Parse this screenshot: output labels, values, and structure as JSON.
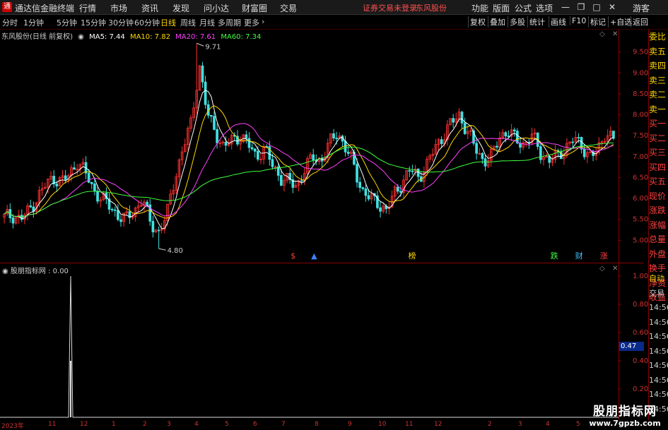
{
  "menubar": {
    "app_title": "通达信金融终端",
    "items": [
      "行情",
      "市场",
      "资讯",
      "发现",
      "问小达",
      "财富圈",
      "交易"
    ],
    "warning": "证券交易未登录",
    "stock_name": "东风股份",
    "right_items": [
      "功能",
      "版面",
      "公式",
      "选项"
    ],
    "guest": "游客"
  },
  "toolbar": {
    "periods": [
      "分时",
      "1分钟",
      "5分钟",
      "15分钟",
      "30分钟",
      "60分钟",
      "日线",
      "周线",
      "月线",
      "多周期",
      "更多"
    ],
    "active_period": "日线",
    "right_buttons": [
      "复权",
      "叠加",
      "多股",
      "统计",
      "画线",
      "F10",
      "标记",
      "+自选",
      "返回"
    ]
  },
  "legend": {
    "name": "东风股份(日线 前复权)",
    "ma5_label": "MA5: 7.44",
    "ma10_label": "MA10: 7.82",
    "ma20_label": "MA20: 7.61",
    "ma60_label": "MA60: 7.34"
  },
  "sublegend": {
    "label": "股朋指标网 : 0.00"
  },
  "price_axis": [
    "9.50",
    "9.00",
    "8.50",
    "8.00",
    "7.50",
    "7.00",
    "6.50",
    "6.00",
    "5.50",
    "5.00"
  ],
  "sub_axis": [
    "1.00",
    "0.80",
    "0.60",
    "0.40",
    "0.20"
  ],
  "sub_current": "0.47",
  "annotations": {
    "high": "9.71",
    "low": "4.80"
  },
  "time_axis": [
    "2023年",
    "11",
    "12",
    "1",
    "2",
    "3",
    "4",
    "5",
    "6",
    "7",
    "8",
    "9",
    "10",
    "11",
    "12",
    "2",
    "3",
    "4",
    "5"
  ],
  "badges": [
    "$",
    "▲",
    "榜",
    "跌",
    "财",
    "涨"
  ],
  "side_list": [
    "委比",
    "卖五",
    "卖四",
    "卖三",
    "卖二",
    "卖一",
    "买一",
    "买二",
    "买三",
    "买四",
    "买五",
    "现价",
    "涨跌",
    "涨幅",
    "总量",
    "外盘",
    "换手",
    "净资",
    "收益"
  ],
  "side_sub": [
    "自动",
    "交易",
    "14:56",
    "14:56",
    "14:56",
    "14:56",
    "14:56",
    "14:56",
    "14:56",
    "14:56"
  ],
  "watermark": {
    "cn": "股朋指标网",
    "url": "www.7gpzb.com"
  },
  "colors": {
    "ma5": "#ffffff",
    "ma10": "#ffd700",
    "ma20": "#ff40ff",
    "ma60": "#40ff40",
    "up": "#ff3030",
    "down": "#40e0e0",
    "grid": "#8a0000"
  },
  "chart_data": {
    "type": "candlestick",
    "title": "东风股份(日线 前复权)",
    "ylim": [
      4.6,
      9.9
    ],
    "high": 9.71,
    "low": 4.8,
    "close_series": [
      5.55,
      5.6,
      5.5,
      5.7,
      6.0,
      6.3,
      6.5,
      6.4,
      6.55,
      6.9,
      6.6,
      6.2,
      6.0,
      5.8,
      5.6,
      5.5,
      5.7,
      6.0,
      5.4,
      5.2,
      5.6,
      6.5,
      7.2,
      7.8,
      9.2,
      8.0,
      7.6,
      7.2,
      7.4,
      7.5,
      7.3,
      7.0,
      7.2,
      6.8,
      6.5,
      6.4,
      6.3,
      6.7,
      7.0,
      6.9,
      7.3,
      7.6,
      7.2,
      6.8,
      6.2,
      6.0,
      5.9,
      5.7,
      6.1,
      6.4,
      6.7,
      6.5,
      6.8,
      7.2,
      7.5,
      7.8,
      8.0,
      7.6,
      7.2,
      6.9,
      7.0,
      7.5,
      7.6,
      7.4,
      7.3,
      7.5,
      7.1,
      6.9,
      7.0,
      7.2,
      7.4,
      7.3,
      7.0,
      7.1,
      7.6,
      7.4
    ]
  }
}
